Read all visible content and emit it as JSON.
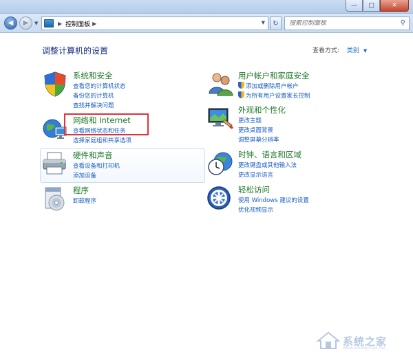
{
  "window": {
    "min_glyph": "—",
    "max_glyph": "□",
    "close_glyph": "✕"
  },
  "navbar": {
    "breadcrumb": "控制面板",
    "search_placeholder": "搜索控制面板",
    "refresh_glyph": "↻",
    "search_glyph": "⚲"
  },
  "content": {
    "heading": "调整计算机的设置",
    "view_by_label": "查看方式:",
    "view_by_value": "类别"
  },
  "categories": {
    "system_security": {
      "title": "系统和安全",
      "links": [
        "查看您的计算机状态",
        "备份您的计算机",
        "查找并解决问题"
      ]
    },
    "network": {
      "title": "网络和 Internet",
      "links": [
        "查看网络状态和任务",
        "选择家庭组和共享选项"
      ]
    },
    "hardware": {
      "title": "硬件和声音",
      "links": [
        "查看设备和打印机",
        "添加设备"
      ]
    },
    "programs": {
      "title": "程序",
      "links": [
        "卸载程序"
      ]
    },
    "user_accounts": {
      "title": "用户帐户和家庭安全",
      "links": [
        "添加或删除用户帐户",
        "为所有用户设置家长控制"
      ]
    },
    "appearance": {
      "title": "外观和个性化",
      "links": [
        "更改主题",
        "更改桌面背景",
        "调整屏幕分辨率"
      ]
    },
    "clock": {
      "title": "时钟、语言和区域",
      "links": [
        "更改键盘或其他输入法",
        "更改显示语言"
      ]
    },
    "ease": {
      "title": "轻松访问",
      "links": [
        "使用 Windows 建议的设置",
        "优化视频显示"
      ]
    }
  },
  "watermark": {
    "text": "系统之家",
    "url": "www.xitongzhijia.net"
  }
}
